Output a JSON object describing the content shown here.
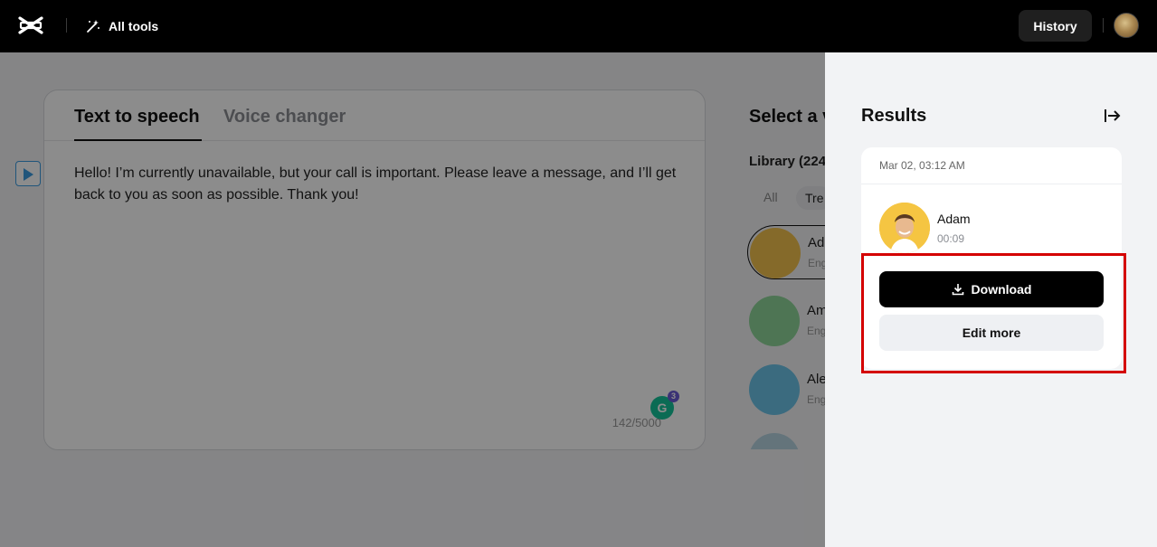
{
  "header": {
    "all_tools_label": "All tools",
    "history_label": "History"
  },
  "editor": {
    "tabs": [
      {
        "label": "Text to speech",
        "active": true
      },
      {
        "label": "Voice changer",
        "active": false
      }
    ],
    "text": "Hello! I’m currently unavailable, but your call is important. Please leave a message, and I’ll get back to you as soon as possible. Thank you!",
    "char_count": "142/5000",
    "grammarly_count": "3"
  },
  "voice_panel": {
    "heading": "Select a v",
    "library_label": "Library (224",
    "filters": [
      "All",
      "Tre"
    ],
    "voices": [
      {
        "name": "Ada",
        "lang": "Eng",
        "selected": true
      },
      {
        "name": "Am",
        "lang": "Eng",
        "selected": false
      },
      {
        "name": "Ale",
        "lang": "Eng",
        "selected": false
      }
    ]
  },
  "results": {
    "title": "Results",
    "date": "Mar 02, 03:12 AM",
    "voice_name": "Adam",
    "duration": "00:09",
    "download_label": "Download",
    "edit_label": "Edit more"
  },
  "colors": {
    "highlight": "#d40000",
    "primary_button": "#000000",
    "secondary_button": "#eef0f3"
  }
}
